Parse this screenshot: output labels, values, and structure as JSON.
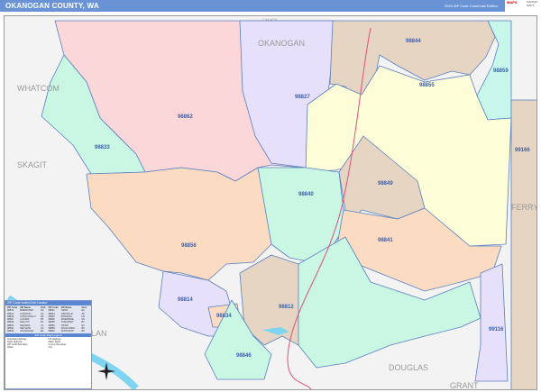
{
  "header": {
    "title": "OKANOGAN COUNTY, WA",
    "edition": "2020 ZIP Code ColorCast Edition",
    "logo": "MAPS",
    "logo_sub": "MARKET MAPS"
  },
  "colors": {
    "header": "#6a93d6",
    "pink": "#fbd7da",
    "green": "#c9f7e3",
    "lavender": "#e6e0fb",
    "brown": "#e6d5c3",
    "yellow": "#fdfdd7",
    "peach": "#fbdcc3",
    "teal": "#c6f7ea",
    "water": "#7fd4f2",
    "highway": "#e0507a"
  },
  "counties": {
    "canada": "CANADA",
    "okanogan": "OKANOGAN",
    "whatcom": "WHATCOM",
    "skagit": "SKAGIT",
    "ferry": "FERRY",
    "douglas": "DOUGLAS",
    "grant": "GRANT",
    "chelan": "LAN"
  },
  "zips": {
    "z98862": "98862",
    "z98827": "98827",
    "z98844": "98844",
    "z98859": "98859",
    "z98855": "98855",
    "z99166": "99166",
    "z98833": "98833",
    "z98840": "98840",
    "z98849": "98849",
    "z98856": "98856",
    "z98841": "98841",
    "z98814": "98814",
    "z98834": "98834",
    "z98812": "98812",
    "z98846": "98846",
    "z99116": "99116"
  },
  "legend": {
    "title": "ZIP Code Index/Grid Locator",
    "headers": [
      "ZIP Code",
      "ZIP Name",
      "Grid",
      "ZIP Code",
      "ZIP Name",
      "Grid"
    ],
    "rows": [
      [
        "98812",
        "BREWSTER",
        "G3",
        "98841",
        "OMAK",
        "E6"
      ],
      [
        "98814",
        "CARLTON",
        "G3",
        "98844",
        "OROVILLE",
        "A6"
      ],
      [
        "98819",
        "CONCONULLY",
        "D5",
        "98846",
        "PATEROS",
        "H3"
      ],
      [
        "98827",
        "LOOMIS",
        "B5",
        "98849",
        "RIVERSIDE",
        "D6"
      ],
      [
        "98829",
        "MALOTT",
        "F5",
        "98855",
        "TONASKET",
        "B7"
      ],
      [
        "98833",
        "MAZAMA",
        "C1",
        "98856",
        "TWISP",
        "E3"
      ],
      [
        "98834",
        "METHOW",
        "G3",
        "98859",
        "WAUCONDA",
        "B8"
      ],
      [
        "98840",
        "OKANOGAN",
        "E5",
        "98862",
        "WINTHROP",
        "B3"
      ]
    ],
    "key_title": "ZIP Code Map Legend",
    "keys": [
      "Interstate Highway",
      "US Highway",
      "State Highway",
      "Major Road",
      "ZIP Code Boundary",
      "County Boundary",
      "Water",
      "City"
    ]
  }
}
